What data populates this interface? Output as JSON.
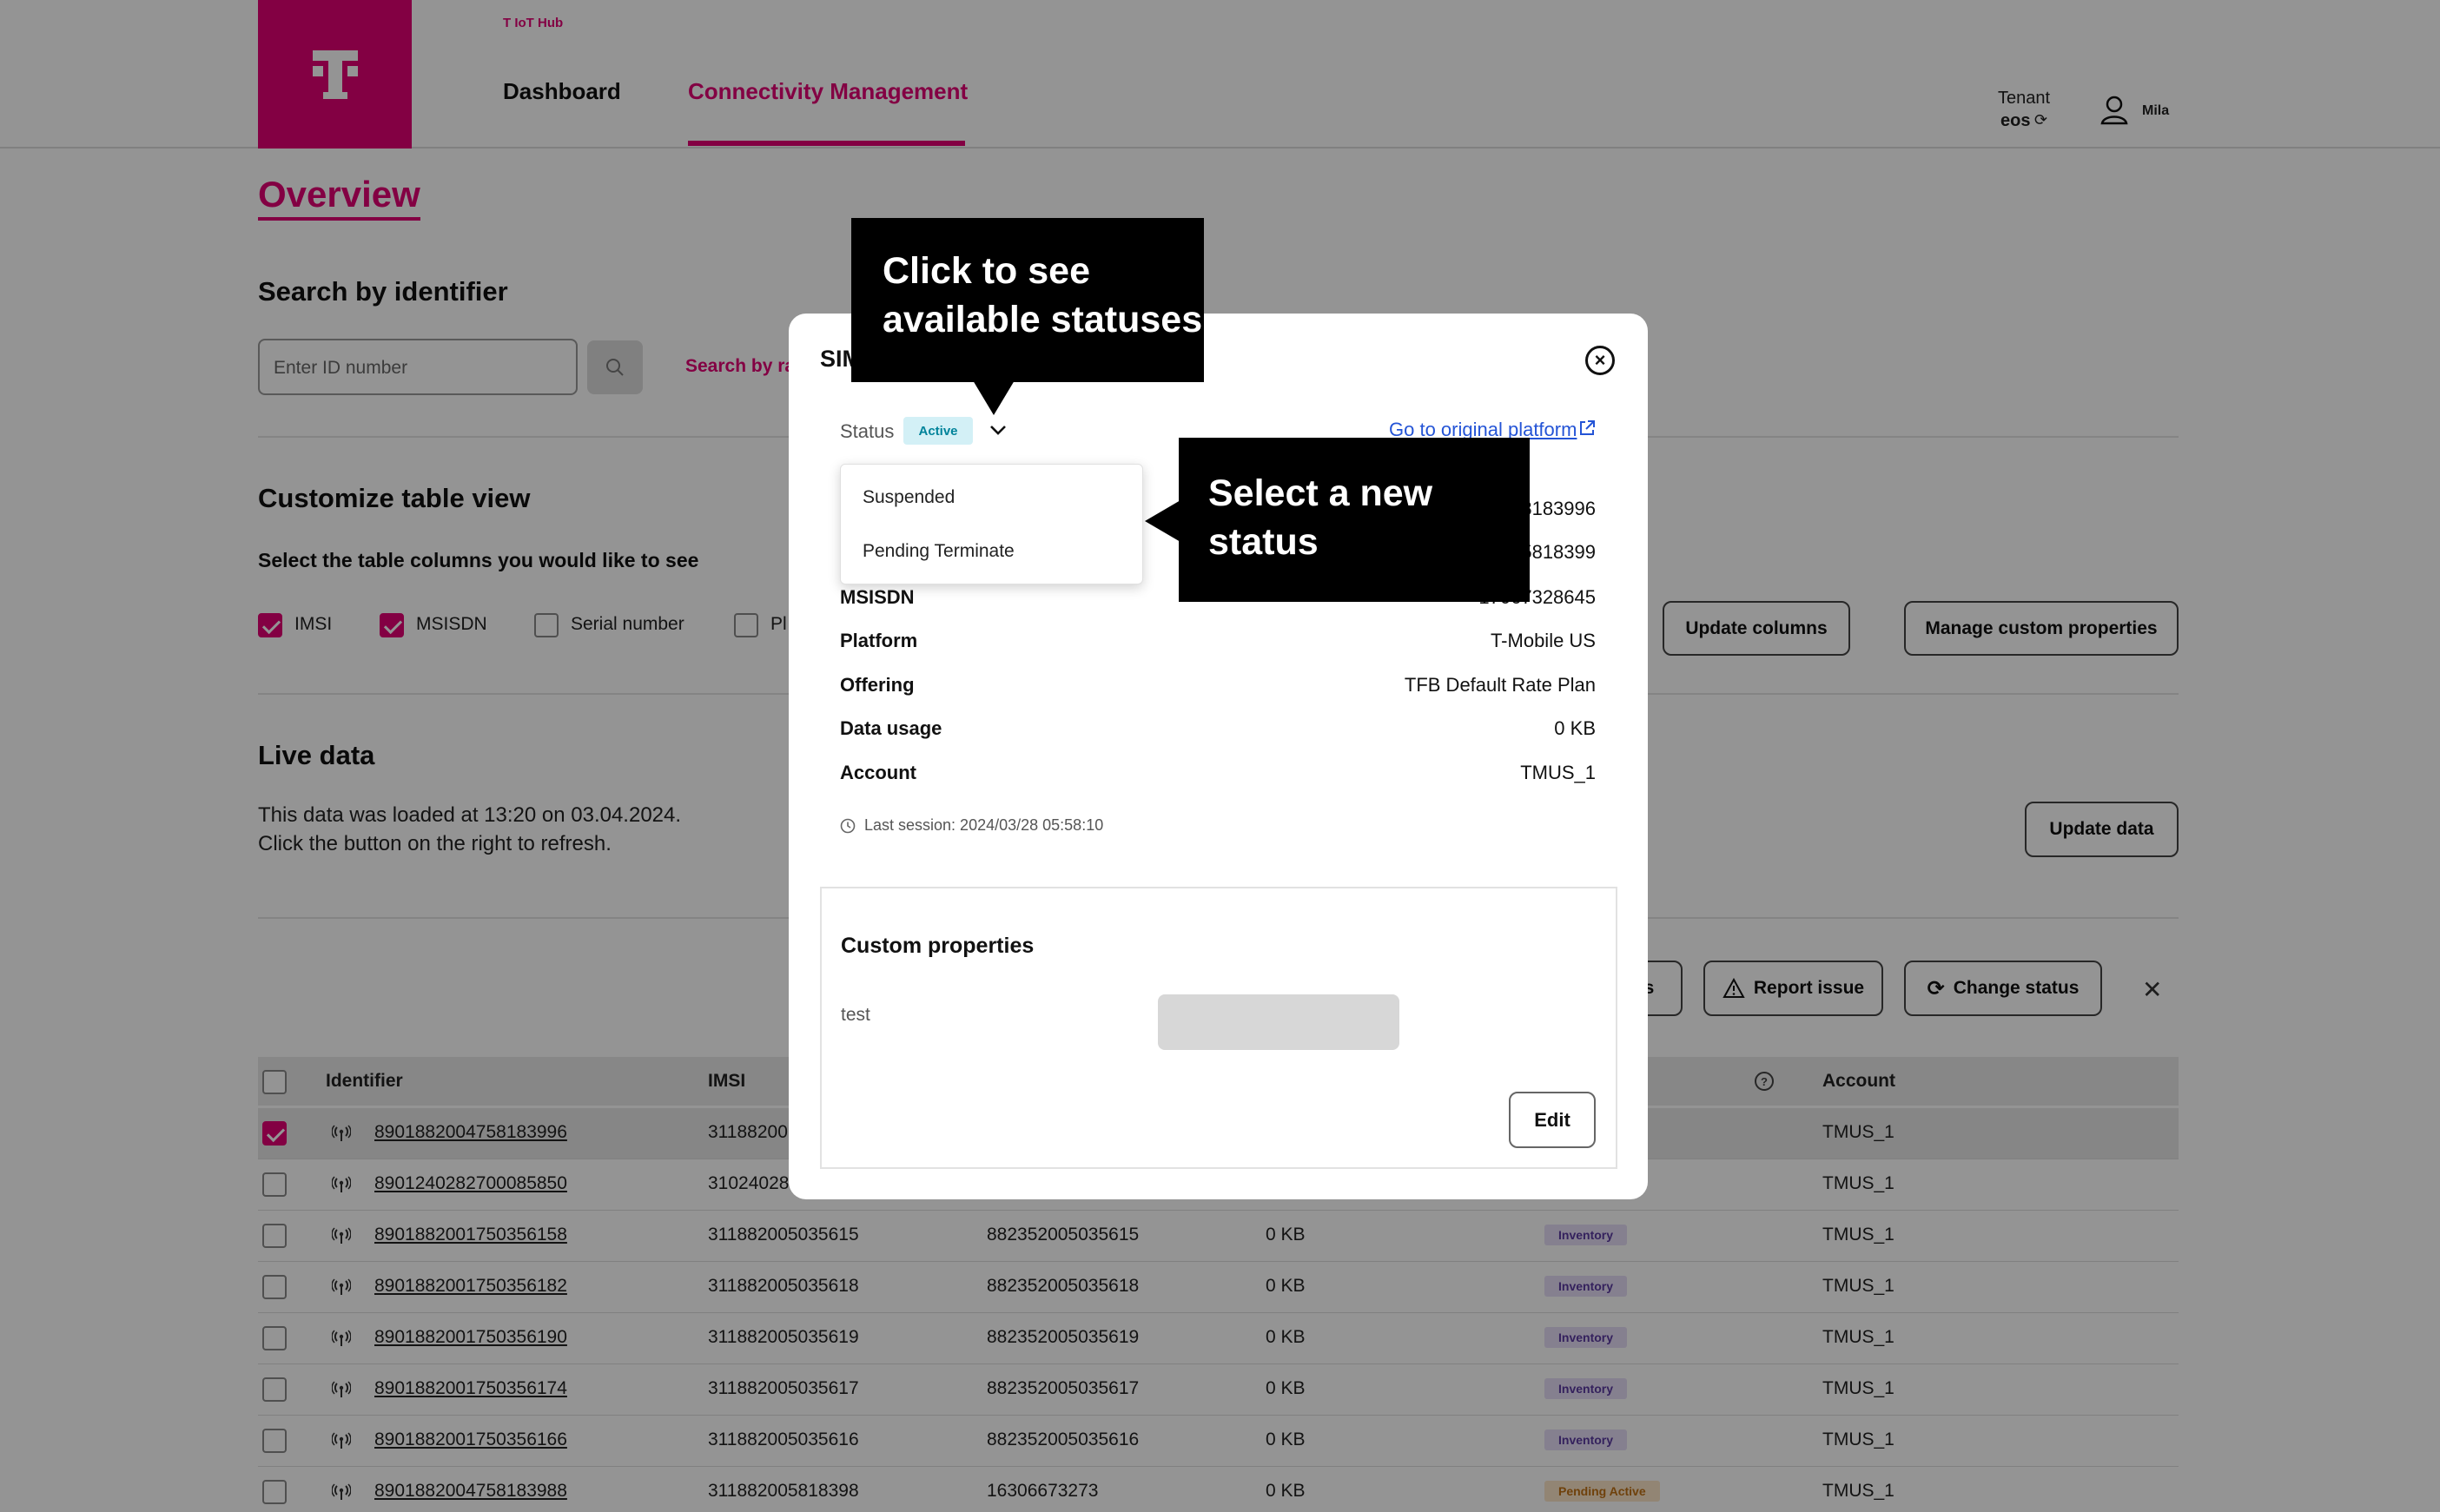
{
  "header": {
    "app_name": "T IoT Hub",
    "nav": [
      "Dashboard",
      "Connectivity Management"
    ],
    "tenant_label": "Tenant",
    "tenant_value": "eos",
    "user_name": "Mila",
    "brand_color": "#e20074"
  },
  "page": {
    "title": "Overview",
    "search_section_title": "Search by identifier",
    "search_placeholder": "Enter ID number",
    "search_range_link": "Search by ra",
    "customize_title": "Customize table view",
    "customize_subtitle": "Select the table columns you would like to see",
    "column_options": [
      {
        "label": "IMSI",
        "checked": true
      },
      {
        "label": "MSISDN",
        "checked": true
      },
      {
        "label": "Serial number",
        "checked": false
      },
      {
        "label": "Pl",
        "checked": false
      }
    ],
    "update_columns_label": "Update columns",
    "manage_custom_label": "Manage custom properties",
    "live_title": "Live data",
    "live_text_1": "This data was loaded at 13:20 on 03.04.2024.",
    "live_text_2": "Click the button on the right to refresh.",
    "update_data_label": "Update data",
    "action_partial_label": "s",
    "report_issue_label": "Report issue",
    "change_status_label": "Change status"
  },
  "table": {
    "headers": {
      "identifier": "Identifier",
      "imsi": "IMSI",
      "account": "Account"
    },
    "rows": [
      {
        "id": "8901882004758183996",
        "imsi": "31188200",
        "msisdn": "",
        "usage": "",
        "status": "",
        "account": "TMUS_1",
        "selected": true
      },
      {
        "id": "8901240282700085850",
        "imsi": "31024028",
        "msisdn": "",
        "usage": "",
        "status": "",
        "account": "TMUS_1",
        "selected": false
      },
      {
        "id": "8901882001750356158",
        "imsi": "311882005035615",
        "msisdn": "882352005035615",
        "usage": "0 KB",
        "status": "Inventory",
        "account": "TMUS_1",
        "selected": false
      },
      {
        "id": "8901882001750356182",
        "imsi": "311882005035618",
        "msisdn": "882352005035618",
        "usage": "0 KB",
        "status": "Inventory",
        "account": "TMUS_1",
        "selected": false
      },
      {
        "id": "8901882001750356190",
        "imsi": "311882005035619",
        "msisdn": "882352005035619",
        "usage": "0 KB",
        "status": "Inventory",
        "account": "TMUS_1",
        "selected": false
      },
      {
        "id": "8901882001750356174",
        "imsi": "311882005035617",
        "msisdn": "882352005035617",
        "usage": "0 KB",
        "status": "Inventory",
        "account": "TMUS_1",
        "selected": false
      },
      {
        "id": "8901882001750356166",
        "imsi": "311882005035616",
        "msisdn": "882352005035616",
        "usage": "0 KB",
        "status": "Inventory",
        "account": "TMUS_1",
        "selected": false
      },
      {
        "id": "8901882004758183988",
        "imsi": "311882005818398",
        "msisdn": "16306673273",
        "usage": "0 KB",
        "status": "Pending Active",
        "account": "TMUS_1",
        "selected": false
      }
    ]
  },
  "modal": {
    "title": "SIM",
    "status_label": "Status",
    "status_value": "Active",
    "original_platform_link": "Go to original platform",
    "details": [
      {
        "label": "",
        "value": "8183996"
      },
      {
        "label": "",
        "value": "5818399"
      },
      {
        "label": "MSISDN",
        "value": "17067328645"
      },
      {
        "label": "Platform",
        "value": "T-Mobile US"
      },
      {
        "label": "Offering",
        "value": "TFB Default Rate Plan"
      },
      {
        "label": "Data usage",
        "value": "0 KB"
      },
      {
        "label": "Account",
        "value": "TMUS_1"
      }
    ],
    "last_session": "Last session: 2024/03/28 05:58:10",
    "custom_properties_title": "Custom properties",
    "custom_property_key": "test",
    "edit_label": "Edit",
    "status_options": [
      "Suspended",
      "Pending Terminate"
    ]
  },
  "callouts": {
    "top_line1": "Click to see",
    "top_line2": "available statuses",
    "right_line1": "Select a new",
    "right_line2": "status"
  }
}
